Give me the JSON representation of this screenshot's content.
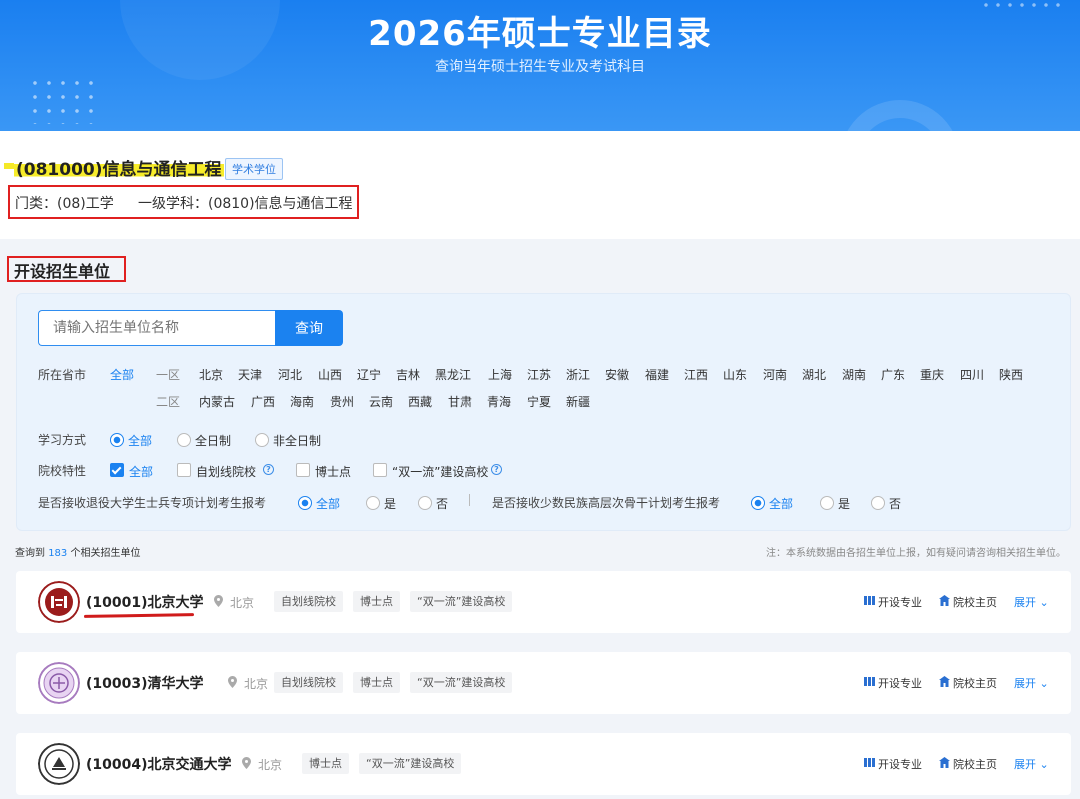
{
  "banner": {
    "title": "2026年硕士专业目录",
    "subtitle": "查询当年硕士招生专业及考试科目"
  },
  "major": {
    "title": "(081000)信息与通信工程",
    "degree_badge": "学术学位",
    "category": "门类：(08)工学",
    "discipline": "一级学科：(0810)信息与通信工程"
  },
  "section_title": "开设招生单位",
  "search": {
    "placeholder": "请输入招生单位名称",
    "button": "查询"
  },
  "filters": {
    "province_label": "所在省市",
    "province_all": "全部",
    "zone1": "一区",
    "zone2": "二区",
    "zone1_provinces": [
      "北京",
      "天津",
      "河北",
      "山西",
      "辽宁",
      "吉林",
      "黑龙江",
      "上海",
      "江苏",
      "浙江",
      "安徽",
      "福建",
      "江西",
      "山东",
      "河南",
      "湖北",
      "湖南",
      "广东",
      "重庆",
      "四川",
      "陕西"
    ],
    "zone2_provinces": [
      "内蒙古",
      "广西",
      "海南",
      "贵州",
      "云南",
      "西藏",
      "甘肃",
      "青海",
      "宁夏",
      "新疆"
    ],
    "study_label": "学习方式",
    "study_options": [
      "全部",
      "全日制",
      "非全日制"
    ],
    "study_selected": "全部",
    "feature_label": "院校特性",
    "feature_options": [
      "全部",
      "自划线院校",
      "博士点",
      "“双一流”建设高校"
    ],
    "feature_checked": "全部",
    "veteran_label": "是否接收退役大学生士兵专项计划考生报考",
    "veteran_options": [
      "全部",
      "是",
      "否"
    ],
    "minority_label": "是否接收少数民族高层次骨干计划考生报考",
    "minority_options": [
      "全部",
      "是",
      "否"
    ]
  },
  "summary": {
    "prefix": "查询到",
    "count": "183",
    "suffix": "个相关招生单位",
    "note": "注：本系统数据由各招生单位上报，如有疑问请咨询相关招生单位。"
  },
  "units": [
    {
      "name": "(10001)北京大学",
      "location": "北京",
      "tags": [
        "自划线院校",
        "博士点",
        "“双一流”建设高校"
      ]
    },
    {
      "name": "(10003)清华大学",
      "location": "北京",
      "tags": [
        "自划线院校",
        "博士点",
        "“双一流”建设高校"
      ]
    },
    {
      "name": "(10004)北京交通大学",
      "location": "北京",
      "tags": [
        "博士点",
        "“双一流”建设高校"
      ]
    }
  ],
  "actions": {
    "majors": "开设专业",
    "homepage": "院校主页",
    "expand": "展开"
  },
  "colors": {
    "primary": "#1b82f0",
    "highlight": "#f7ec2a",
    "annotation_red": "#e02020"
  }
}
